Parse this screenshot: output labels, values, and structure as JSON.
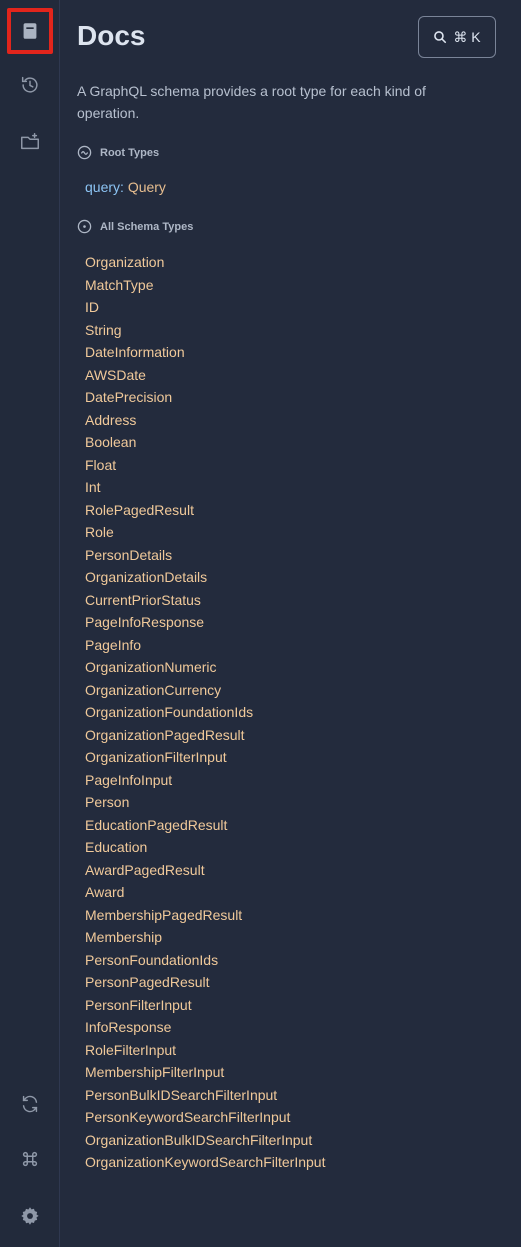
{
  "docs": {
    "title": "Docs",
    "search_shortcut": "⌘ K",
    "description": "A GraphQL schema provides a root type for each kind of operation.",
    "root_types_label": "Root Types",
    "root_field_name": "query",
    "root_field_sep": ": ",
    "root_field_type": "Query",
    "all_types_label": "All Schema Types",
    "types": [
      "Organization",
      "MatchType",
      "ID",
      "String",
      "DateInformation",
      "AWSDate",
      "DatePrecision",
      "Address",
      "Boolean",
      "Float",
      "Int",
      "RolePagedResult",
      "Role",
      "PersonDetails",
      "OrganizationDetails",
      "CurrentPriorStatus",
      "PageInfoResponse",
      "PageInfo",
      "OrganizationNumeric",
      "OrganizationCurrency",
      "OrganizationFoundationIds",
      "OrganizationPagedResult",
      "OrganizationFilterInput",
      "PageInfoInput",
      "Person",
      "EducationPagedResult",
      "Education",
      "AwardPagedResult",
      "Award",
      "MembershipPagedResult",
      "Membership",
      "PersonFoundationIds",
      "PersonPagedResult",
      "PersonFilterInput",
      "InfoResponse",
      "RoleFilterInput",
      "MembershipFilterInput",
      "PersonBulkIDSearchFilterInput",
      "PersonKeywordSearchFilterInput",
      "OrganizationBulkIDSearchFilterInput",
      "OrganizationKeywordSearchFilterInput"
    ]
  },
  "sidebar": {
    "icons": [
      "docs-book-icon",
      "history-icon",
      "add-folder-icon",
      "refresh-icon",
      "command-key-icon",
      "settings-gear-icon"
    ]
  },
  "colors": {
    "background": "#232b3d",
    "type_link": "#f0c99a",
    "field_name": "#8cc4f4",
    "active_highlight": "#e2251c"
  }
}
